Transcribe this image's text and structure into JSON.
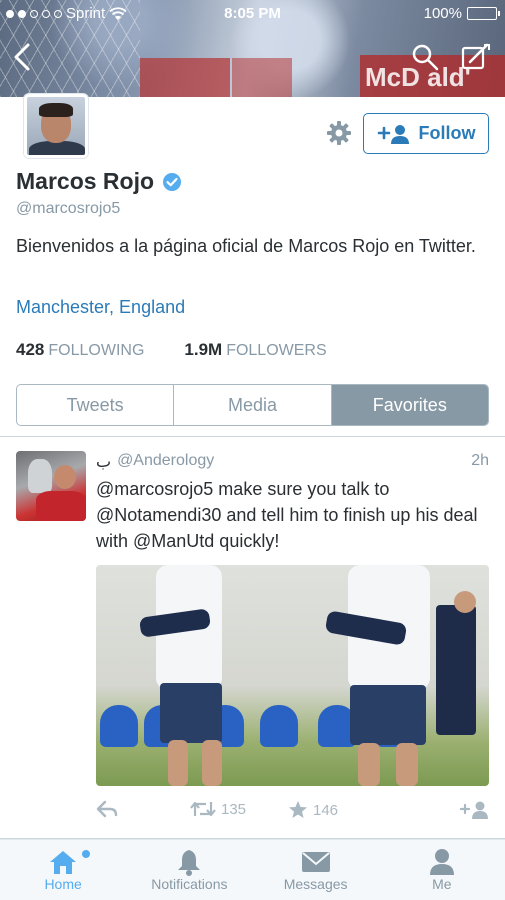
{
  "status_bar": {
    "carrier": "Sprint",
    "time": "8:05 PM",
    "battery": "100%"
  },
  "profile": {
    "name": "Marcos Rojo",
    "handle": "@marcosrojo5",
    "bio": "Bienvenidos a la página oficial de Marcos Rojo en Twitter.",
    "location": "Manchester, England",
    "following_count": "428",
    "following_label": "FOLLOWING",
    "followers_count": "1.9M",
    "followers_label": "FOLLOWERS",
    "follow_label": "Follow",
    "verified": true
  },
  "banner": {
    "ad_text": "McD       ald'"
  },
  "tabs": [
    {
      "label": "Tweets",
      "active": false
    },
    {
      "label": "Media",
      "active": false
    },
    {
      "label": "Favorites",
      "active": true
    }
  ],
  "tweet": {
    "author_name": "ب",
    "author_handle": "@Anderology",
    "time": "2h",
    "text": "@marcosrojo5 make sure you talk to @Notamendi30 and tell him to finish up his deal with @ManUtd quickly!",
    "retweets": "135",
    "favorites": "146"
  },
  "tab_bar": [
    {
      "label": "Home",
      "icon": "home-icon",
      "active": true
    },
    {
      "label": "Notifications",
      "icon": "bell-icon",
      "active": false
    },
    {
      "label": "Messages",
      "icon": "envelope-icon",
      "active": false
    },
    {
      "label": "Me",
      "icon": "person-icon",
      "active": false
    }
  ],
  "colors": {
    "link_blue": "#2b7bb9",
    "tab_active_bg": "#8899a6",
    "muted_text": "#8899a6",
    "home_active": "#55acee",
    "verified_badge": "#55acee"
  }
}
